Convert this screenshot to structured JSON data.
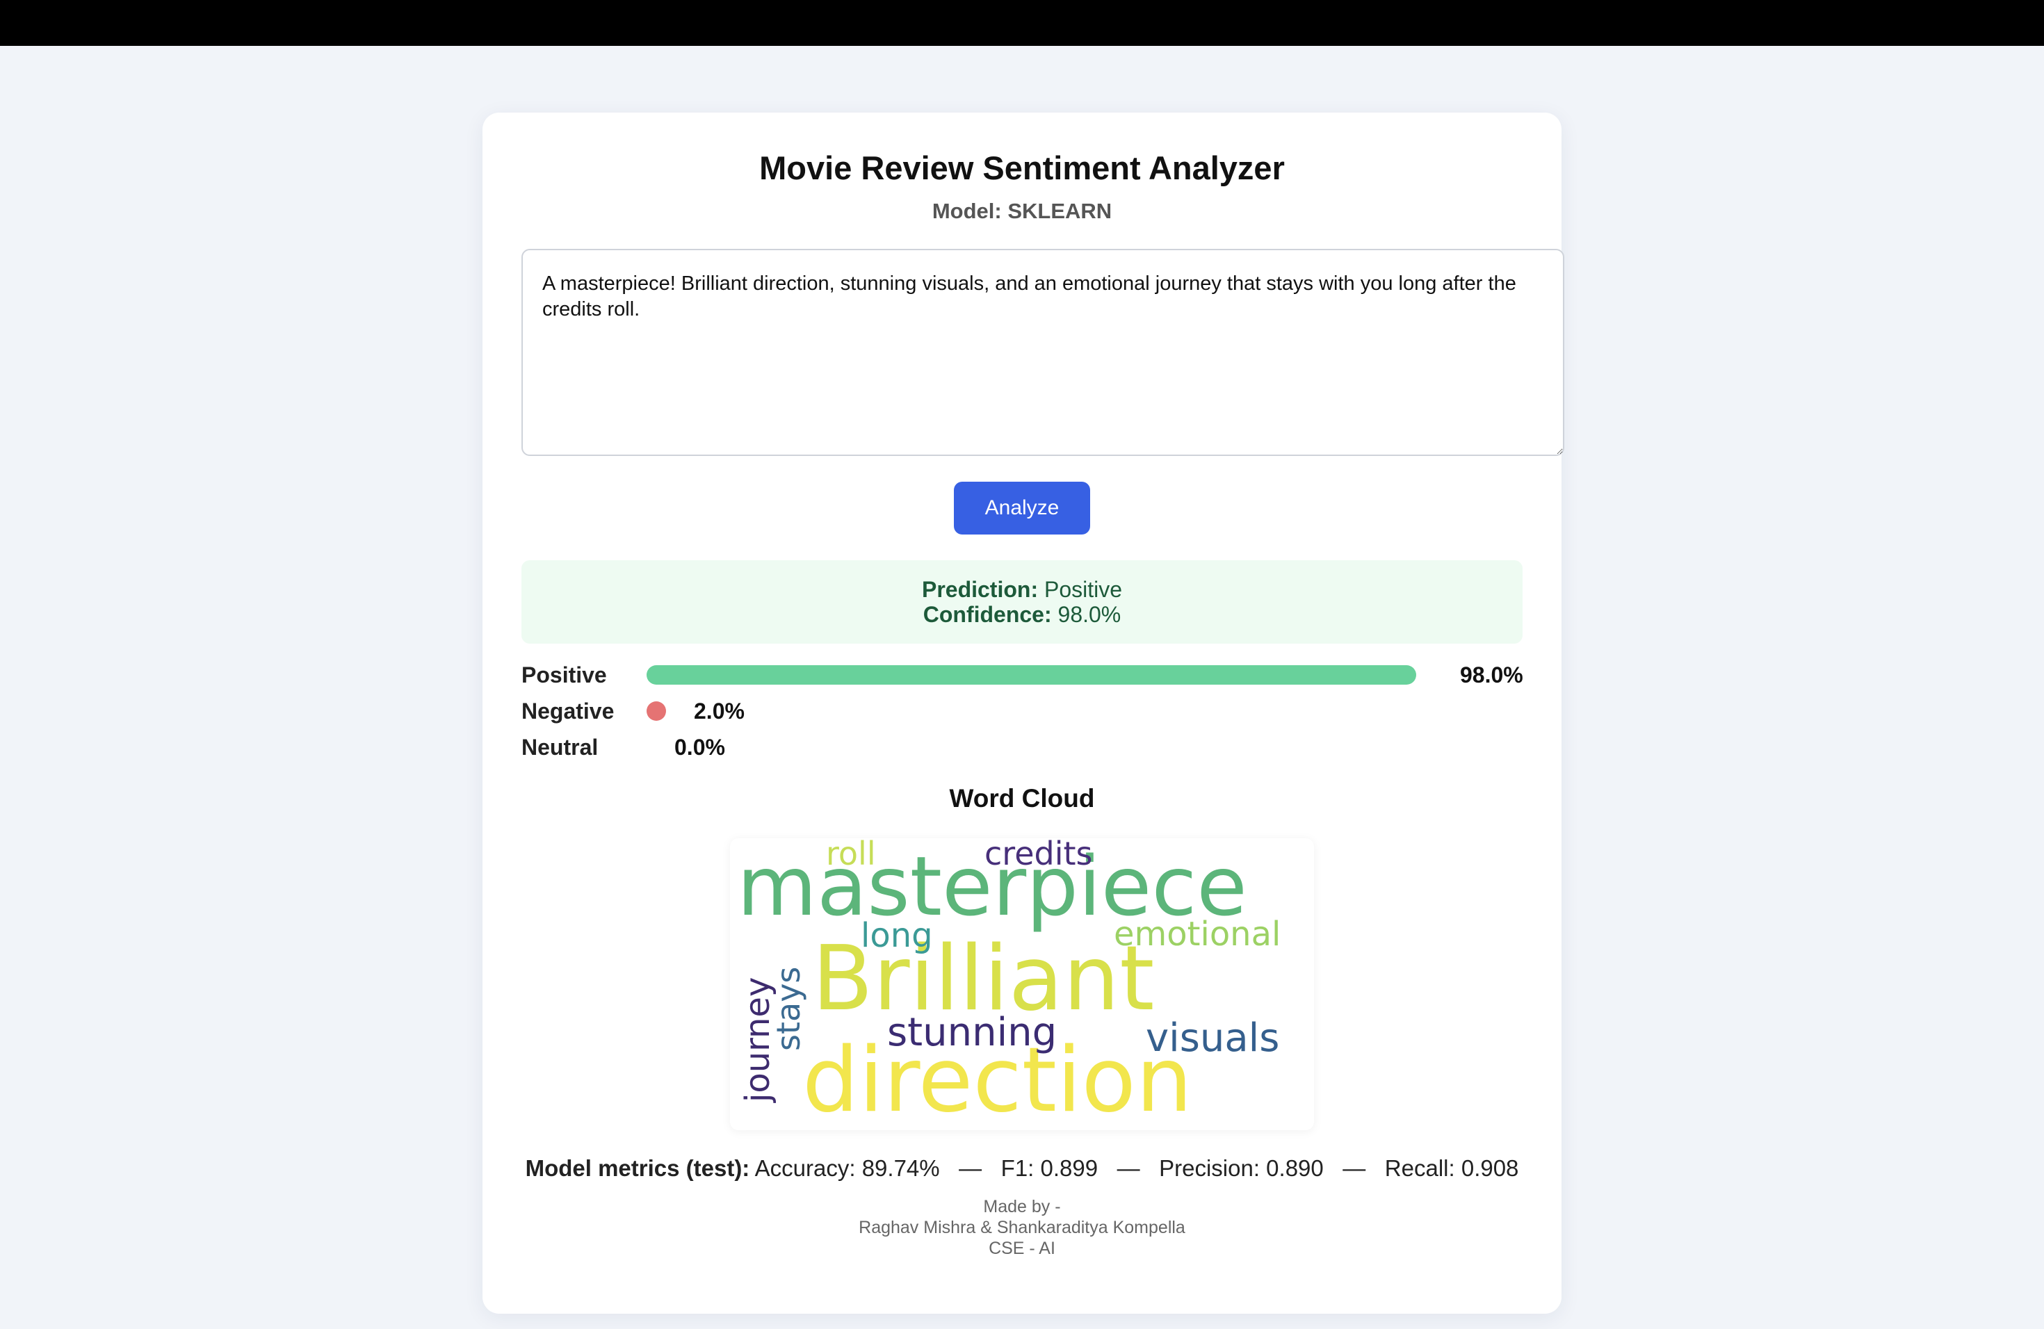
{
  "app": {
    "title": "Movie Review Sentiment Analyzer",
    "model_label": "Model: SKLEARN"
  },
  "review": {
    "text": "A masterpiece! Brilliant direction, stunning visuals, and an emotional journey that stays with you long after the credits roll."
  },
  "actions": {
    "analyze_label": "Analyze"
  },
  "prediction": {
    "prediction_label": "Prediction:",
    "prediction_value": "Positive",
    "confidence_label": "Confidence:",
    "confidence_value": "98.0%"
  },
  "probabilities": [
    {
      "label": "Positive",
      "value": 0.98,
      "display": "98.0%",
      "color": "#68d19b"
    },
    {
      "label": "Negative",
      "value": 0.02,
      "display": "2.0%",
      "color": "#e57373"
    },
    {
      "label": "Neutral",
      "value": 0.0,
      "display": "0.0%",
      "color": "#9e9e9e"
    }
  ],
  "word_cloud": {
    "title": "Word Cloud",
    "words": [
      {
        "text": "masterpiece",
        "color": "#5cb57a"
      },
      {
        "text": "Brilliant",
        "color": "#d8e04a"
      },
      {
        "text": "direction",
        "color": "#f2e64d"
      },
      {
        "text": "credits",
        "color": "#472f7a"
      },
      {
        "text": "roll",
        "color": "#c6dd57"
      },
      {
        "text": "long",
        "color": "#3b9a96"
      },
      {
        "text": "emotional",
        "color": "#9cd164"
      },
      {
        "text": "journey",
        "color": "#3d2b6e"
      },
      {
        "text": "stays",
        "color": "#3b6a91"
      },
      {
        "text": "stunning",
        "color": "#3b2c72"
      },
      {
        "text": "visuals",
        "color": "#355f8d"
      }
    ]
  },
  "metrics": {
    "label": "Model metrics (test):",
    "accuracy": "Accuracy: 89.74%",
    "f1": "F1: 0.899",
    "precision": "Precision: 0.890",
    "recall": "Recall: 0.908",
    "separator": "—"
  },
  "footer": {
    "line1": "Made by -",
    "line2": "Raghav Mishra & Shankaraditya Kompella",
    "line3": "CSE - AI"
  }
}
